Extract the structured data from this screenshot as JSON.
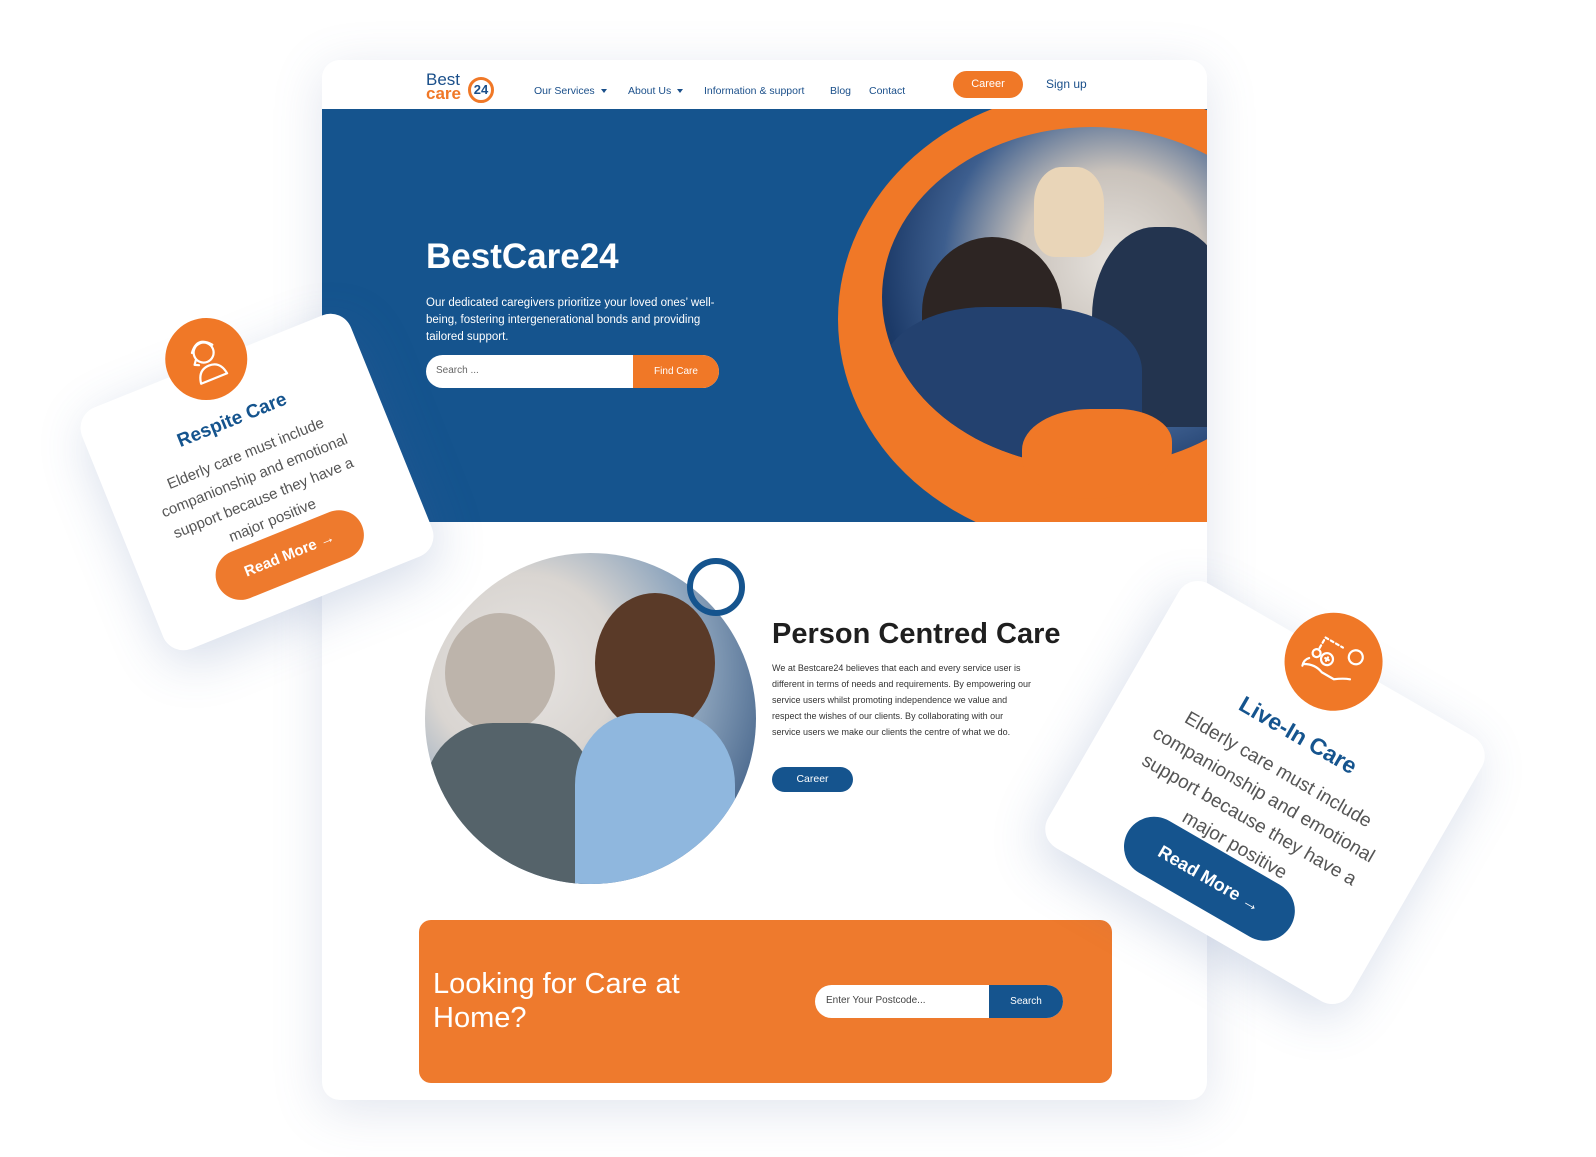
{
  "colors": {
    "brand_blue": "#15548e",
    "brand_orange": "#f07827"
  },
  "logo": {
    "line1": "Best",
    "line2": "care",
    "number": "24"
  },
  "nav": {
    "items": [
      {
        "label": "Our Services",
        "dropdown": true
      },
      {
        "label": "About Us",
        "dropdown": true
      },
      {
        "label": "Information & support",
        "dropdown": false
      },
      {
        "label": "Blog",
        "dropdown": false
      },
      {
        "label": "Contact",
        "dropdown": false
      }
    ],
    "career_label": "Career",
    "signup_label": "Sign up"
  },
  "hero": {
    "title": "BestCare24",
    "text": "Our dedicated caregivers prioritize your loved ones’ well-being, fostering intergenerational bonds and providing tailored support.",
    "search_placeholder": "Search ...",
    "search_button": "Find Care"
  },
  "person_centred": {
    "title": "Person Centred Care",
    "text": "We at Bestcare24 believes that each and every service user is different in terms of needs and requirements. By empowering our service users whilst promoting independence we value and respect the wishes of our clients. By collaborating with our service users we make our clients the centre of what we do.",
    "button": "Career"
  },
  "cta": {
    "title": "Looking for Care at Home?",
    "search_placeholder": "Enter Your Postcode...",
    "search_button": "Search"
  },
  "cards": [
    {
      "title": "Respite Care",
      "text": "Elderly care must include companionship and emotional support because they have a major positive",
      "button": "Read More →",
      "icon": "caregiver-icon"
    },
    {
      "title": "Live-In Care",
      "text": "Elderly care must include companionship and emotional support because they have a major positive",
      "button": "Read More →",
      "icon": "care-hand-icon"
    }
  ]
}
